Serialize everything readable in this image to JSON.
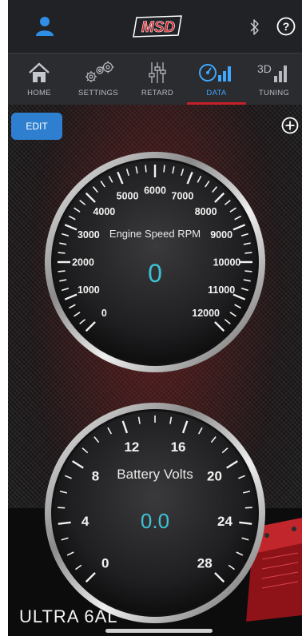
{
  "header": {
    "logo_text": "MSD",
    "icons": [
      "user-icon",
      "bluetooth-icon",
      "help-icon"
    ],
    "help_glyph": "?"
  },
  "nav": {
    "tabs": [
      {
        "label": "HOME",
        "icon": "home-icon",
        "active": false
      },
      {
        "label": "SETTINGS",
        "icon": "gears-icon",
        "active": false
      },
      {
        "label": "RETARD",
        "icon": "sliders-icon",
        "active": false
      },
      {
        "label": "DATA",
        "icon": "gauge-bars-icon",
        "active": true
      },
      {
        "label": "TUNING",
        "icon": "3d-bars-icon",
        "active": false,
        "icon_text": "3D"
      }
    ]
  },
  "toolbar": {
    "edit_label": "EDIT",
    "add_icon": "plus-circle-icon"
  },
  "gauges": [
    {
      "title": "Engine Speed RPM",
      "value": "0",
      "scale_labels": [
        "0",
        "1000",
        "2000",
        "3000",
        "4000",
        "5000",
        "6000",
        "7000",
        "8000",
        "9000",
        "10000",
        "11000",
        "12000"
      ]
    },
    {
      "title": "Battery Volts",
      "value": "0.0",
      "scale_labels": [
        "0",
        "4",
        "8",
        "12",
        "16",
        "20",
        "24",
        "28"
      ]
    }
  ],
  "footer": {
    "product_name": "ULTRA 6AL"
  },
  "colors": {
    "accent": "#2f7fd0",
    "active_tab": "#3fa8ff",
    "tab_underline": "#c8202a",
    "gauge_value": "#3cc3d6",
    "logo": "#d21f26"
  }
}
